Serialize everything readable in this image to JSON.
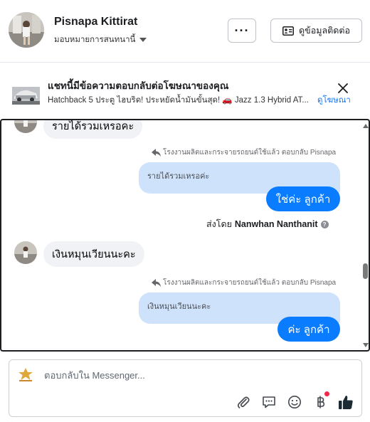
{
  "header": {
    "name": "Pisnapa Kittirat",
    "assign_label": "มอบหมายการสนทนานี้",
    "more_label": "···",
    "contact_label": "ดูข้อมูลติดต่อ"
  },
  "ad": {
    "title": "แชทนี้มีข้อความตอบกลับต่อโฆษณาของคุณ",
    "description": "Hatchback 5 ประตู ไฮบริด! ประหยัดน้ำมันขั้นสุด! 🚗 Jazz 1.3 Hybrid AT...",
    "link_label": "ดูโฆษณา"
  },
  "conversation": {
    "msg1": "รายได้รวมเหรอคะ",
    "reply1": {
      "label": "โรงงานผลิตและกระจายรถยนต์ใช้แล้ว ตอบกลับ Pisnapa",
      "quoted": "รายได้รวมเหรอค่ะ",
      "reply": "ใช่ค่ะ  ลูกค้า"
    },
    "sent_by_prefix": "ส่งโดย",
    "sent_by_name": "Nanwhan Nanthanit",
    "help_glyph": "?",
    "msg2": "เงินหมุนเวียนนะคะ",
    "reply2": {
      "label": "โรงงานผลิตและกระจายรถยนต์ใช้แล้ว ตอบกลับ Pisnapa",
      "quoted": "เงินหมุนเวียนนะคะ",
      "reply": "ค่ะ  ลูกค้า"
    }
  },
  "composer": {
    "placeholder": "ตอบกลับใน Messenger...",
    "icons": [
      "paperclip-icon",
      "saved-reply-icon",
      "emoji-icon",
      "baht-icon",
      "like-icon"
    ]
  },
  "colors": {
    "accent": "#0a7cff",
    "link": "#1877f2",
    "incoming_bubble": "#f0f2f5",
    "quoted_bubble": "#cfe2fb",
    "notification_dot": "#f02849"
  }
}
